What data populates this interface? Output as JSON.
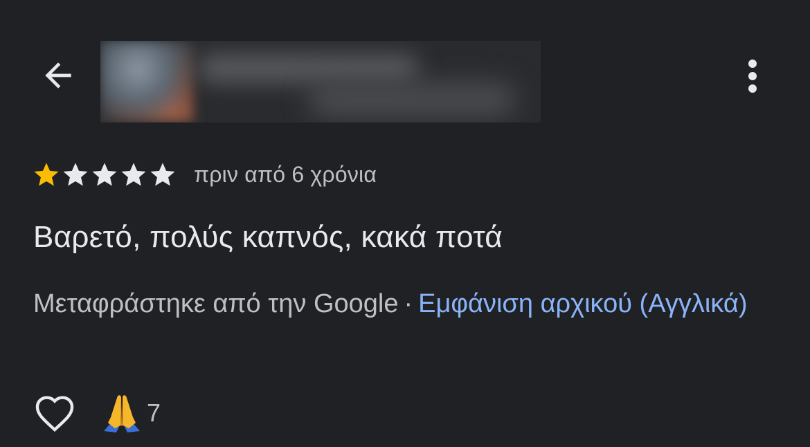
{
  "header": {
    "back_icon": "arrow-back-icon",
    "menu_icon": "more-vert-icon"
  },
  "review": {
    "rating": 1,
    "max_rating": 5,
    "time_ago": "πριν από 6 χρόνια",
    "text": "Βαρετό, πολύς καπνός, κακά ποτά",
    "translated_by": "Μεταφράστηκε από την Google",
    "separator": "·",
    "show_original_link": "Εμφάνιση αρχικού (Αγγλικά)"
  },
  "actions": {
    "like_icon": "heart-outline-icon",
    "reaction_icon": "folded-hands-emoji",
    "reaction_count": "7"
  },
  "colors": {
    "background": "#202124",
    "star_filled": "#fbbc04",
    "star_empty": "#e8eaed",
    "link": "#8ab4f8",
    "secondary_text": "#bdc1c6",
    "primary_text": "#e8eaed"
  }
}
